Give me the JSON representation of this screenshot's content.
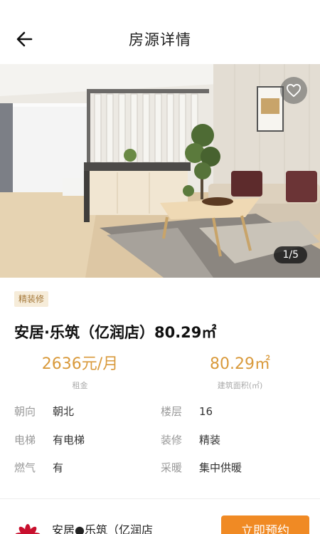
{
  "header": {
    "title": "房源详情",
    "back_icon": "arrow-left-icon"
  },
  "gallery": {
    "counter": "1/5",
    "favorite_icon": "heart-icon"
  },
  "listing": {
    "tag": "精装修",
    "title": "安居·乐筑（亿润店）80.29㎡",
    "price": {
      "value": "2636元/月",
      "label": "租金"
    },
    "area": {
      "value": "80.29㎡",
      "label": "建筑面积(㎡)"
    },
    "attributes": [
      {
        "key": "朝向",
        "value": "朝北"
      },
      {
        "key": "楼层",
        "value": "16"
      },
      {
        "key": "电梯",
        "value": "有电梯"
      },
      {
        "key": "装修",
        "value": "精装"
      },
      {
        "key": "燃气",
        "value": "有"
      },
      {
        "key": "采暖",
        "value": "集中供暖"
      }
    ]
  },
  "bottom_bar": {
    "store_name": "安居●乐筑（亿润店",
    "book_label": "立即预约"
  },
  "colors": {
    "accent": "#f08a24",
    "price": "#d99a3c",
    "tag_bg": "#f6ecd9",
    "tag_text": "#a5793a"
  }
}
